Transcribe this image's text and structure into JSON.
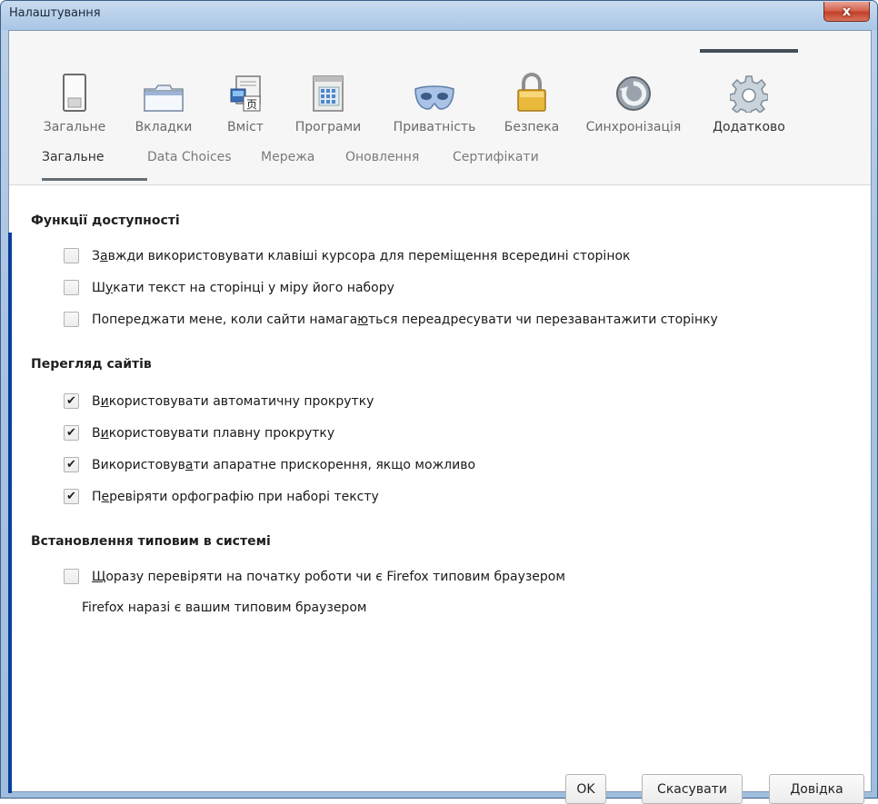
{
  "window": {
    "title": "Налаштування",
    "close_glyph": "x"
  },
  "panes": [
    {
      "label": "Загальне",
      "icon": "general-icon"
    },
    {
      "label": "Вкладки",
      "icon": "tabs-icon"
    },
    {
      "label": "Вміст",
      "icon": "content-icon"
    },
    {
      "label": "Програми",
      "icon": "applications-icon"
    },
    {
      "label": "Приватність",
      "icon": "privacy-mask-icon"
    },
    {
      "label": "Безпека",
      "icon": "security-lock-icon"
    },
    {
      "label": "Синхронізація",
      "icon": "sync-icon"
    },
    {
      "label": "Додатково",
      "icon": "advanced-gear-icon",
      "selected": true
    }
  ],
  "subtabs": [
    {
      "label": "Загальне",
      "selected": true
    },
    {
      "label": "Data Choices"
    },
    {
      "label": "Мережа"
    },
    {
      "label": "Оновлення"
    },
    {
      "label": "Сертифікати"
    }
  ],
  "accessibility": {
    "title": "Функції доступності",
    "items": [
      {
        "pre": "З",
        "acc": "а",
        "post": "вжди використовувати клавіші курсора для переміщення всередині сторінок",
        "checked": false
      },
      {
        "pre": "Ш",
        "acc": "у",
        "post": "кати текст на сторінці у міру його набору",
        "checked": false
      },
      {
        "pre": "Попереджати мене, коли сайти намага",
        "acc": "ю",
        "post": "ться переадресувати чи перезавантажити сторінку",
        "checked": false
      }
    ]
  },
  "browsing": {
    "title": "Перегляд сайтів",
    "items": [
      {
        "pre": "В",
        "acc": "и",
        "post": "користовувати автоматичну прокрутку",
        "checked": true
      },
      {
        "pre": "В",
        "acc": "и",
        "post": "користовувати плавну прокрутку",
        "checked": true
      },
      {
        "pre": "Використовув",
        "acc": "а",
        "post": "ти апаратне прискорення, якщо можливо",
        "checked": true
      },
      {
        "pre": "П",
        "acc": "е",
        "post": "ревіряти орфографію при наборі тексту",
        "checked": true
      }
    ]
  },
  "system_defaults": {
    "title": "Встановлення типовим в системі",
    "check": {
      "pre": "",
      "acc": "Щ",
      "post": "оразу перевіряти на початку роботи чи є Firefox типовим браузером",
      "checked": false
    },
    "status": "Firefox наразі є вашим типовим браузером"
  },
  "buttons": {
    "ok": "OK",
    "cancel": "Скасувати",
    "help_acc": "Д",
    "help_rest": "овідка"
  },
  "colors": {
    "title_bar": "#b7cfe9",
    "close_button": "#c3402a",
    "selected_indicator": "#424f5a",
    "left_accent": "#0b3e9a"
  }
}
